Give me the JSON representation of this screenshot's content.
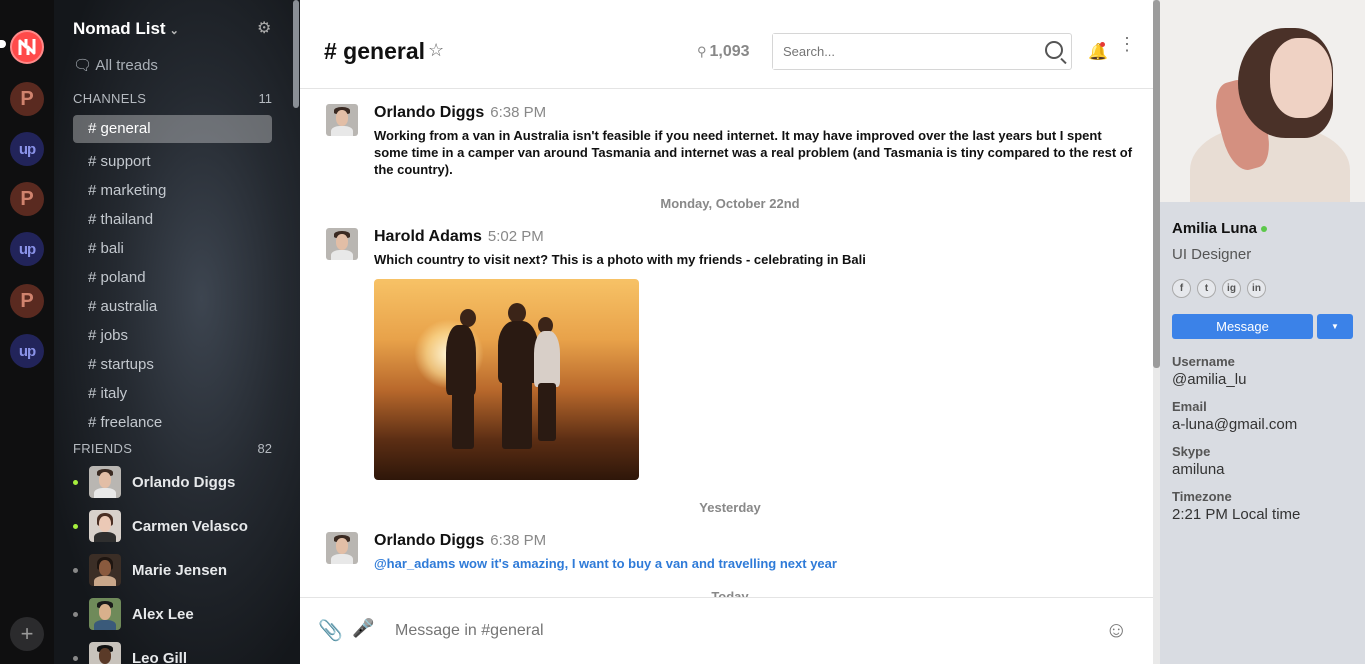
{
  "team": {
    "name": "Nomad List",
    "all_threads": "All treads"
  },
  "workspaces": [
    {
      "label": "",
      "kind": "nomad"
    },
    {
      "label": "P",
      "kind": "p"
    },
    {
      "label": "up",
      "kind": "up"
    },
    {
      "label": "P",
      "kind": "p"
    },
    {
      "label": "up",
      "kind": "up"
    },
    {
      "label": "P",
      "kind": "p"
    },
    {
      "label": "up",
      "kind": "up"
    }
  ],
  "rail_add": "+",
  "channels": {
    "title": "CHANNELS",
    "count": "11",
    "items": [
      "# general",
      "# support",
      "# marketing",
      "# thailand",
      "# bali",
      "# poland",
      "# australia",
      "# jobs",
      "# startups",
      "# italy",
      "# freelance"
    ]
  },
  "friends": {
    "title": "FRIENDS",
    "count": "82",
    "items": [
      {
        "name": "Orlando Diggs",
        "online": true
      },
      {
        "name": "Carmen Velasco",
        "online": true
      },
      {
        "name": "Marie Jensen",
        "online": false
      },
      {
        "name": "Alex Lee",
        "online": false
      },
      {
        "name": "Leo Gill",
        "online": false
      }
    ]
  },
  "header": {
    "channel": "# general",
    "members": "1,093",
    "search_placeholder": "Search..."
  },
  "messages": [
    {
      "author": "Orlando Diggs",
      "time": "6:38 PM",
      "text": "Working from a van in Australia isn't feasible if you need internet. It may have improved over the last years but I spent some time in a camper van around Tasmania and internet was a real problem (and Tasmania is tiny compared to the rest of the country)."
    },
    {
      "author": "Harold Adams",
      "time": "5:02 PM",
      "text": "Which country to visit next? This is a photo with my friends - celebrating in Bali"
    },
    {
      "author": "Orlando Diggs",
      "time": "6:38 PM",
      "text": "@har_adams wow it's amazing, I want to buy a van and travelling next year"
    }
  ],
  "day_separators": [
    "Monday, October 22nd",
    "Yesterday",
    "Today"
  ],
  "composer": {
    "placeholder": "Message in #general"
  },
  "profile": {
    "name": "Amilia Luna",
    "role": "UI Designer",
    "social": [
      "f",
      "t",
      "ig",
      "in"
    ],
    "message_button": "Message",
    "fields": [
      {
        "label": "Username",
        "value": "@amilia_lu"
      },
      {
        "label": "Email",
        "value": "a-luna@gmail.com"
      },
      {
        "label": "Skype",
        "value": "amiluna"
      },
      {
        "label": "Timezone",
        "value": "2:21 PM Local time"
      }
    ]
  },
  "colors": {
    "accent": "#3b82e8",
    "online": "#a6ef3d",
    "mention": "#2f7bd8"
  }
}
